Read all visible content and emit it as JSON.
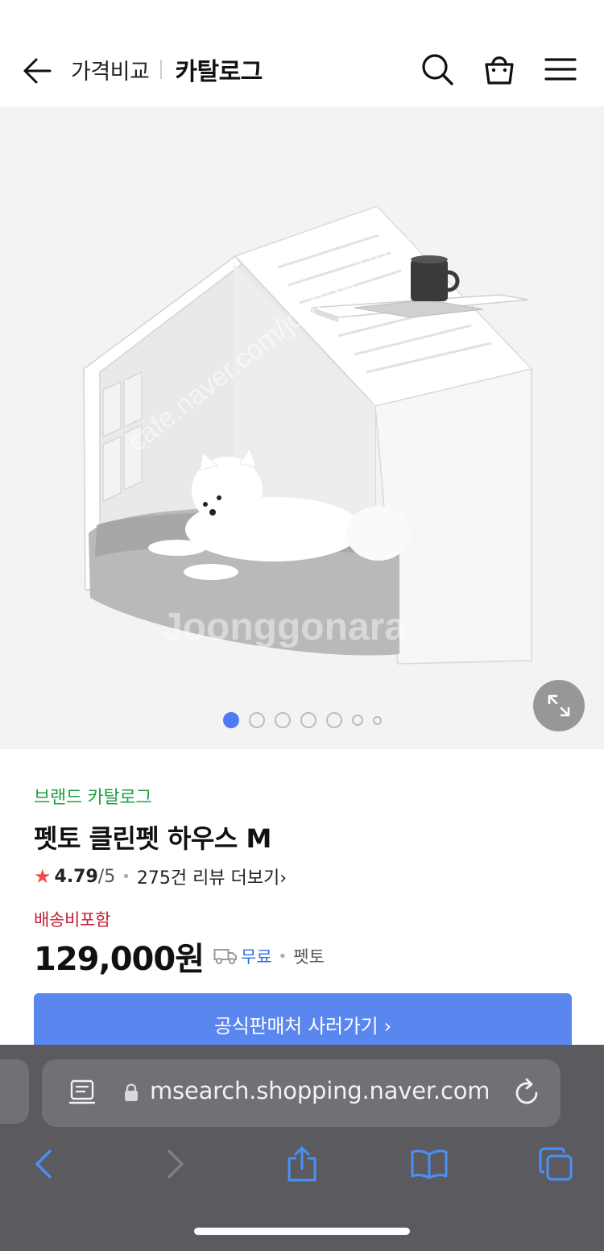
{
  "header": {
    "breadcrumb_price_compare": "가격비교",
    "breadcrumb_catalog": "카탈로그",
    "icons": [
      "arrow-left-icon",
      "search-icon",
      "shopping-bag-icon",
      "menu-icon"
    ]
  },
  "gallery": {
    "watermarks": [
      "cafe.naver.com/joonggonara",
      "Joonggonara"
    ],
    "page_count": 7,
    "active_index": 0
  },
  "product": {
    "brand_label": "브랜드 카탈로그",
    "title": "펫토 클린펫 하우스 M",
    "rating_value": "4.79",
    "rating_max": "/5",
    "review_text": "275건 리뷰 더보기",
    "review_arrow": "›",
    "shipping_included": "배송비포함",
    "price": "129,000원",
    "shipping_free": "무료",
    "seller": "펫토",
    "buy_button": "공식판매처 사러가기 ›"
  },
  "browser": {
    "url": "msearch.shopping.naver.com"
  },
  "colors": {
    "brand_green": "#1ea03f",
    "accent_blue": "#5a86ef",
    "star_red": "#f04a4a",
    "ship_red": "#c0213b",
    "free_blue": "#2f6fe0",
    "browser_bg": "#5b5b5f"
  }
}
